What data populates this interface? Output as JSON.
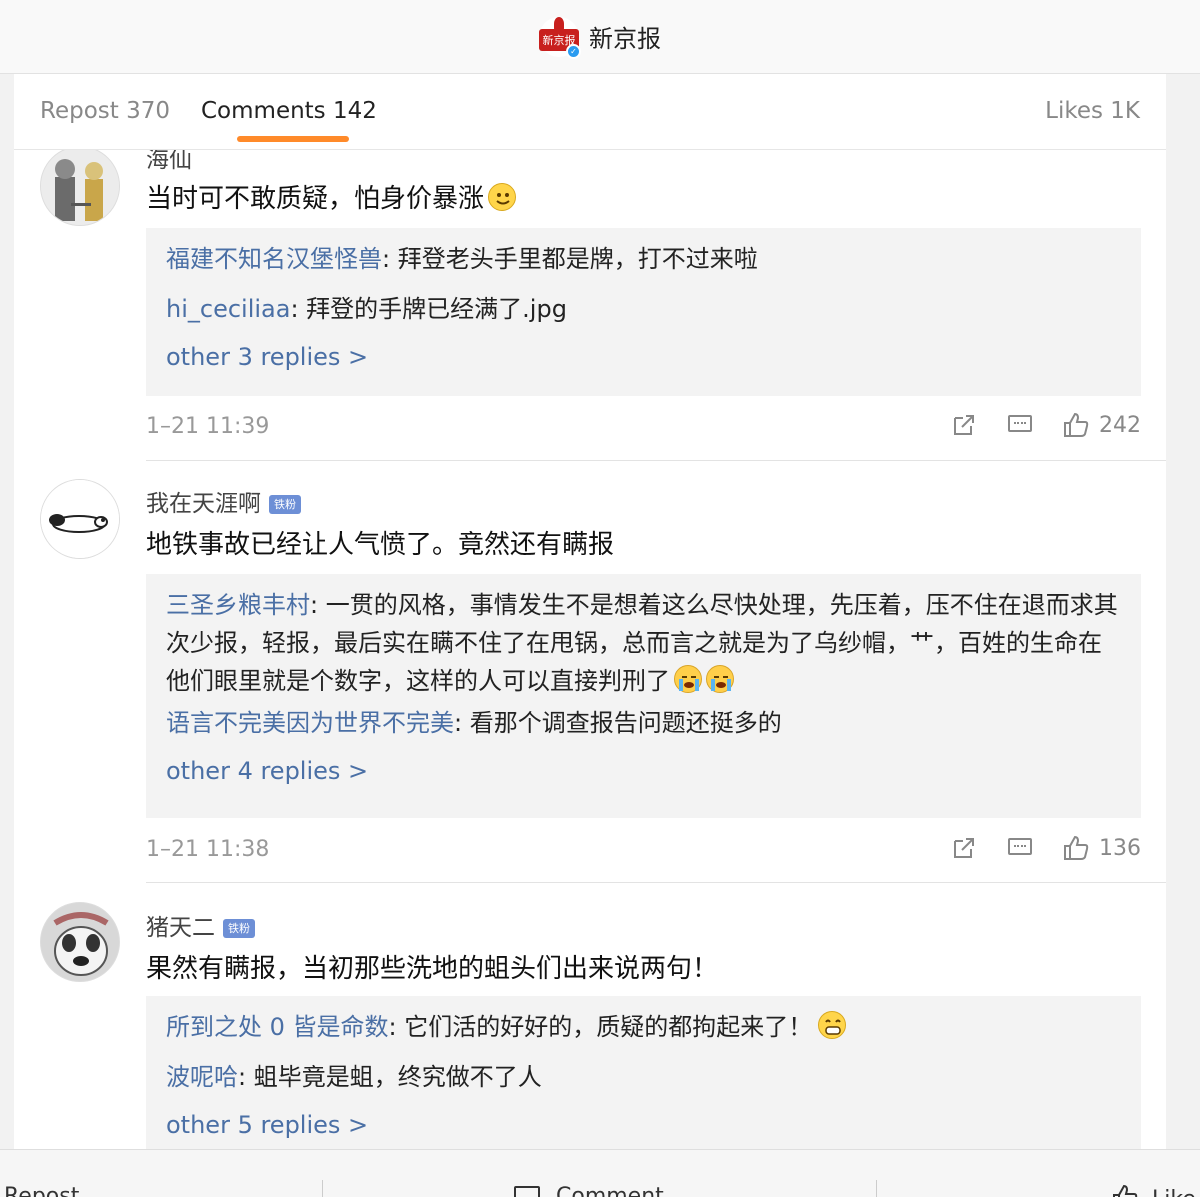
{
  "header": {
    "title": "新京报",
    "logo_text": "新京报"
  },
  "tabs": {
    "repost": "Repost 370",
    "comments": "Comments 142",
    "likes": "Likes 1K"
  },
  "comments": [
    {
      "user": "海仙",
      "badge": "",
      "text": "当时可不敢质疑，怕身价暴涨",
      "emoji": "smile-emoji",
      "replies": [
        {
          "user": "福建不知名汉堡怪兽",
          "text": ": 拜登老头手里都是牌，打不过来啦"
        },
        {
          "user": "hi_ceciliaa",
          "text": ": 拜登的手牌已经满了.jpg"
        }
      ],
      "more": "other 3 replies >",
      "time": "1–21 11:39",
      "likes": "242"
    },
    {
      "user": "我在天涯啊",
      "badge": "铁粉",
      "text": "地铁事故已经让人气愤了。竟然还有瞒报",
      "replies": [
        {
          "user": "三圣乡粮丰村",
          "text": ": 一贯的风格，事情发生不是想着这么尽快处理，先压着，压不住在退而求其次少报，轻报，最后实在瞒不住了在甩锅，总而言之就是为了乌纱帽，艹，百姓的生命在他们眼里就是个数字，这样的人可以直接判刑了"
        },
        {
          "user": "语言不完美因为世界不完美",
          "text": ": 看那个调查报告问题还挺多的"
        }
      ],
      "more": "other 4 replies >",
      "time": "1–21 11:38",
      "likes": "136"
    },
    {
      "user": "猪天二",
      "badge": "铁粉",
      "text": "果然有瞒报，当初那些洗地的蛆头们出来说两句！",
      "replies": [
        {
          "user": "所到之处 0 皆是命数",
          "text": ": 它们活的好好的，质疑的都拘起来了！"
        },
        {
          "user": "波呢哈",
          "text": ": 蛆毕竟是蛆，终究做不了人"
        }
      ],
      "more": "other 5 replies >"
    }
  ],
  "bottombar": {
    "repost": "Repost",
    "comment": "Comment",
    "like": "Like"
  },
  "colors": {
    "accent": "#ff8a2a",
    "link": "#4a6fa5",
    "badge": "#6d8fd6",
    "verified": "#2a9bf0"
  }
}
